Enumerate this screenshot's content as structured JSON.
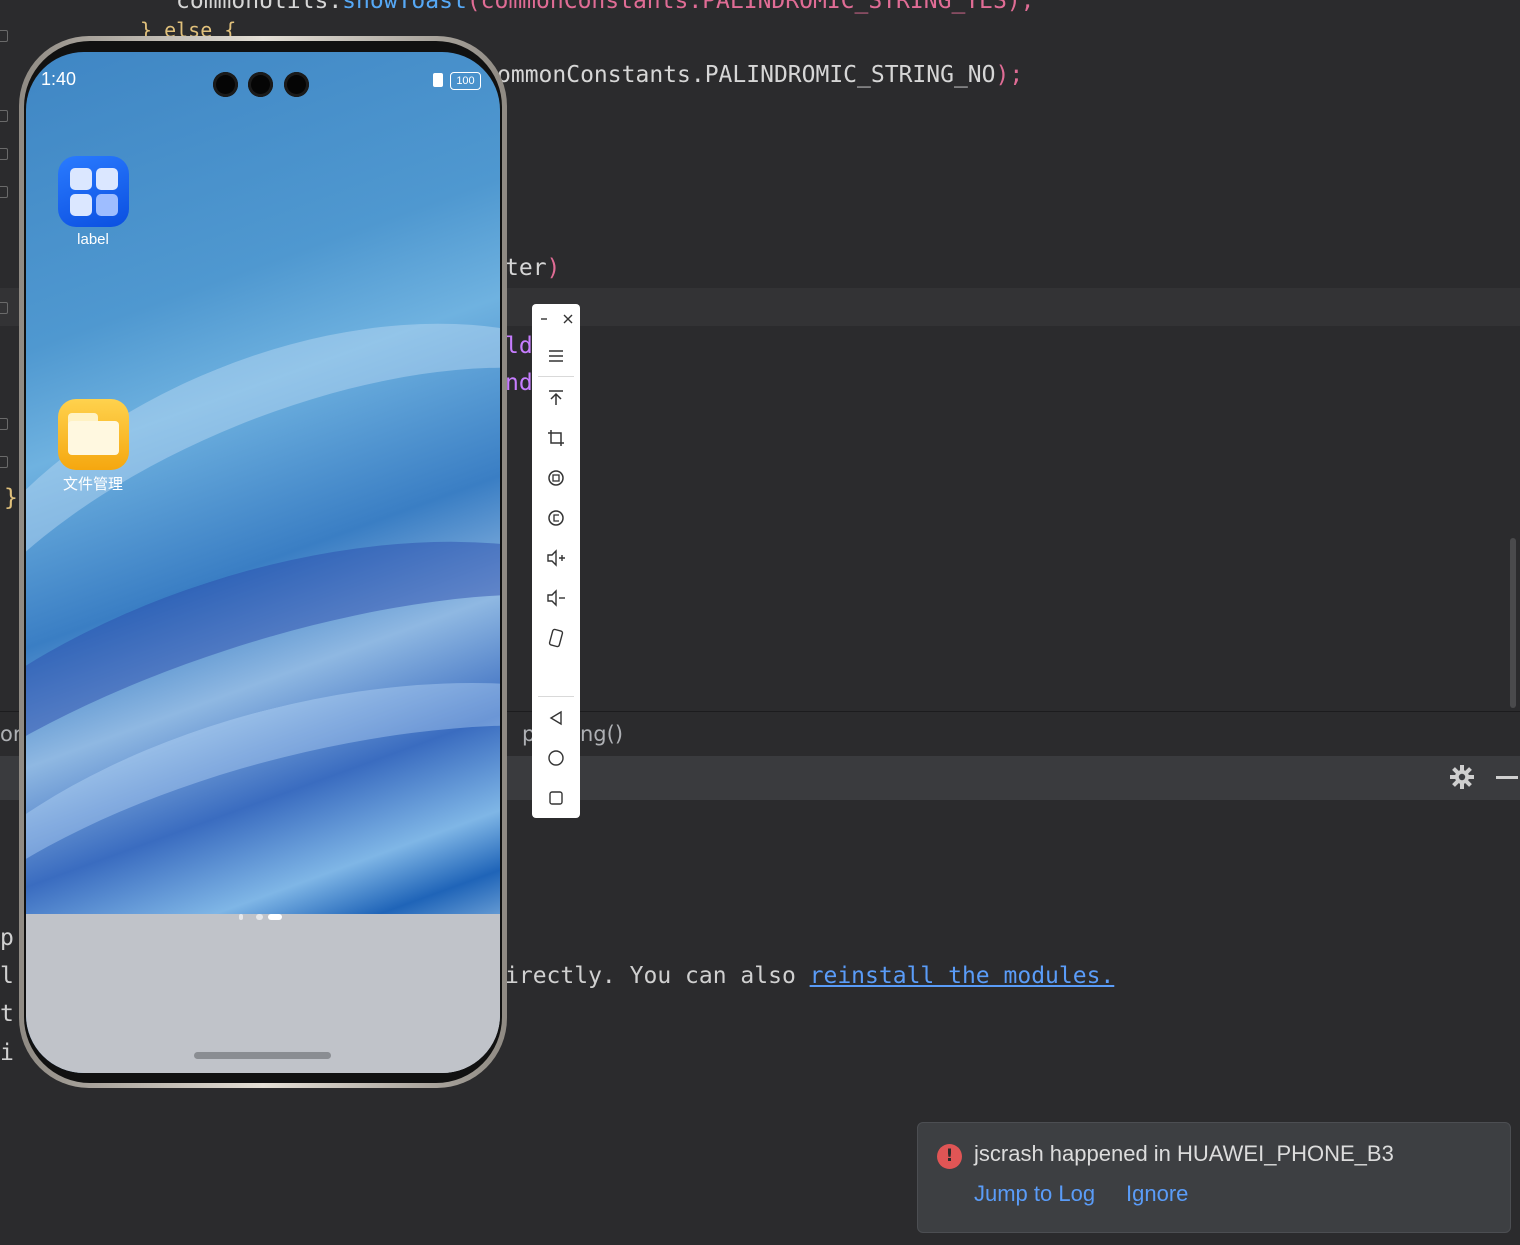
{
  "editor": {
    "line0_a": "commonUtils.",
    "line0_fn": "showToast",
    "line0_b": "(commonConstants.PALINDROMIC_STRING_YES);",
    "line0_brace": "} else {",
    "line1": "ommonConstants.PALINDROMIC_STRING_NO",
    "line1_end": ");",
    "line2": "ter",
    "line2_end": ")",
    "line3_purple": "ldi",
    "line3_end": "),",
    "line4_purple": "ndo",
    "line4_end": "')",
    "closing_brace": "}"
  },
  "breadcrumb": {
    "left": "or",
    "right_a": "p",
    "right_b": "ng()"
  },
  "log": {
    "lines": [
      "p",
      "l",
      "t",
      "i"
    ],
    "message": "irectly. You can also ",
    "link": "reinstall the modules."
  },
  "notification": {
    "title": "jscrash happened in HUAWEI_PHONE_B3",
    "jump": "Jump to Log",
    "ignore": "Ignore"
  },
  "phone": {
    "time": "1:40",
    "battery": "100",
    "apps": [
      {
        "label": "label",
        "icon": "grid-app-icon"
      },
      {
        "label": "文件管理",
        "icon": "folder-app-icon"
      }
    ]
  },
  "toolbar": {
    "items": [
      "minimize-icon",
      "close-icon",
      "menu-icon",
      "pin-top-icon",
      "crop-icon",
      "rotate-left-icon",
      "rotate-right-icon",
      "volume-up-icon",
      "volume-down-icon",
      "shake-icon",
      "back-icon",
      "home-icon",
      "recents-icon"
    ]
  },
  "colors": {
    "accent_link": "#5a9cf8",
    "error": "#e05555",
    "ide_bg": "#2b2b2d"
  }
}
